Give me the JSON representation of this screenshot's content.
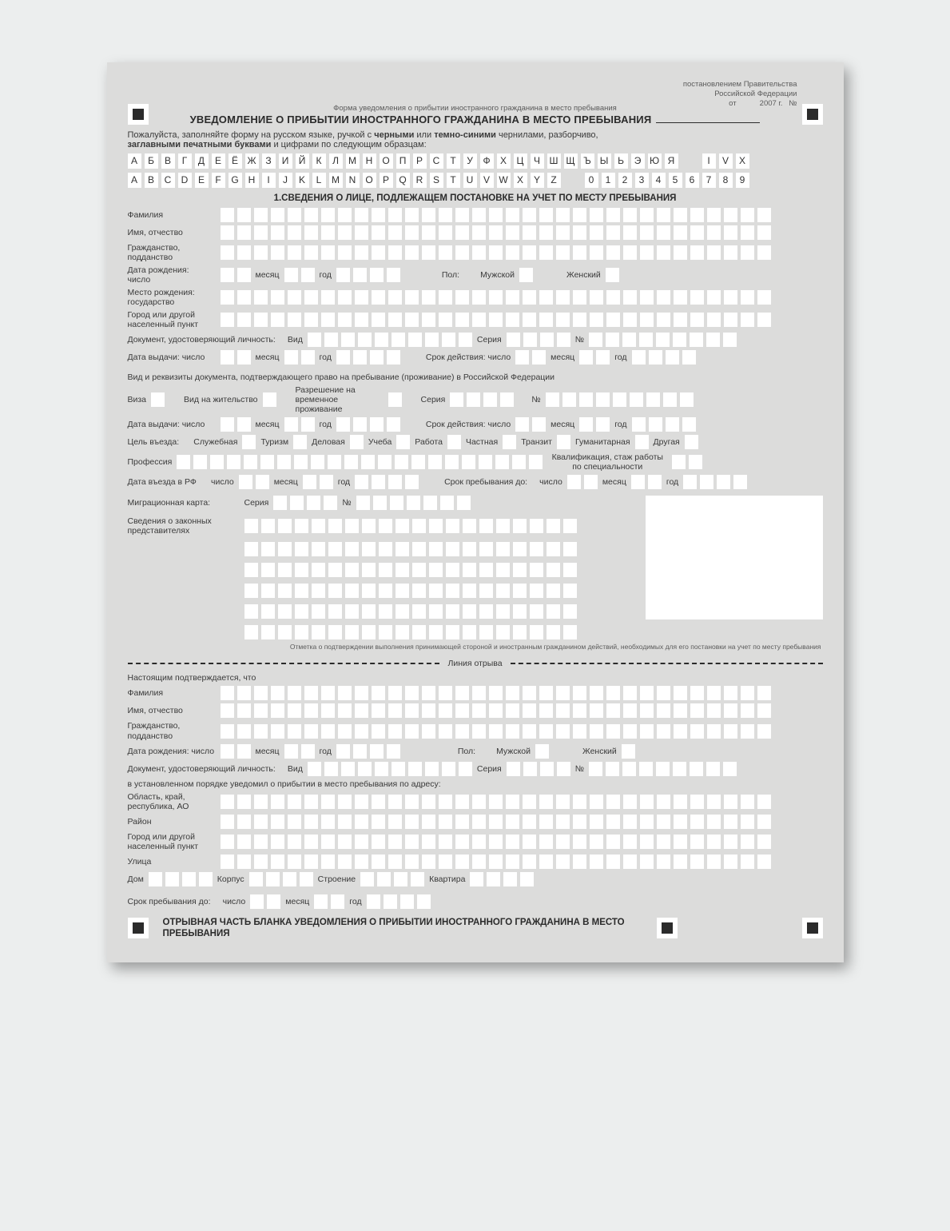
{
  "decree": {
    "l1": "постановлением Правительства",
    "l2": "Российской Федерации",
    "l3_pre": "от",
    "l3_year": "2007 г.",
    "l3_no": "№"
  },
  "header": {
    "subtitle": "Форма уведомления о прибытии иностранного гражданина в место пребывания",
    "title": "УВЕДОМЛЕНИЕ О ПРИБЫТИИ ИНОСТРАННОГО ГРАЖДАНИНА В МЕСТО ПРЕБЫВАНИЯ"
  },
  "instr_parts": {
    "p1": "Пожалуйста, заполняйте форму на русском языке, ручкой с ",
    "b1": "черными",
    "p2": " или ",
    "b2": "темно-синими",
    "p3": " чернилами, разборчиво,",
    "b3": "заглавными печатными буквами",
    "p4": " и цифрами по следующим образцам:"
  },
  "samples": {
    "cyr": "АБВГДЕЁЖЗИЙКЛМНОПРСТУФХЦЧШЩЪЫЬЭЮЯ",
    "roman": "IVX",
    "lat": "ABCDEFGHIJKLMNOPQRSTUVWXYZ",
    "digits": "0123456789"
  },
  "sec1_title": "1.СВЕДЕНИЯ О ЛИЦЕ, ПОДЛЕЖАЩЕМ ПОСТАНОВКЕ НА УЧЕТ ПО МЕСТУ ПРЕБЫВАНИЯ",
  "labels": {
    "surname": "Фамилия",
    "name_patr": "Имя, отчество",
    "citizenship": "Гражданство, подданство",
    "birth_date": "Дата рождения:",
    "day": "число",
    "month": "месяц",
    "year": "год",
    "sex": "Пол:",
    "male": "Мужской",
    "female": "Женский",
    "birth_country": "Место рождения: государство",
    "birth_city": "Город или другой населенный пункт",
    "id_doc": "Документ, удостоверяющий личность:",
    "kind": "Вид",
    "series": "Серия",
    "number": "№",
    "issue_date": "Дата выдачи: число",
    "valid_until": "Срок действия: число",
    "right_doc": "Вид и реквизиты документа, подтверждающего право на пребывание (проживание) в Российской Федерации",
    "visa": "Виза",
    "residence": "Вид на жительство",
    "temp_permit": "Разрешение на временное проживание",
    "purpose": "Цель въезда:",
    "p_service": "Служебная",
    "p_tourism": "Туризм",
    "p_business": "Деловая",
    "p_study": "Учеба",
    "p_work": "Работа",
    "p_private": "Частная",
    "p_transit": "Транзит",
    "p_human": "Гуманитарная",
    "p_other": "Другая",
    "profession": "Профессия",
    "qualif": "Квалификация, стаж работы по специальности",
    "entry_date": "Дата въезда в РФ",
    "stay_until": "Срок пребывания до:",
    "mig_card": "Миграционная карта:",
    "reps": "Сведения о законных представителях",
    "stamp_note": "Отметка о подтверждении выполнения принимающей стороной и иностранным гражданином действий, необходимых для его постановки на учет по месту пребывания"
  },
  "tear_label": "Линия отрыва",
  "tear": {
    "confirm": "Настоящим подтверждается, что",
    "notified": "в установленном порядке уведомил о прибытии в место пребывания по адресу:",
    "region": "Область, край, республика, АО",
    "district": "Район",
    "city": "Город или другой населенный пункт",
    "street": "Улица",
    "house": "Дом",
    "korpus": "Корпус",
    "building": "Строение",
    "flat": "Квартира",
    "stay_until": "Срок пребывания до:"
  },
  "footer_title": "ОТРЫВНАЯ ЧАСТЬ БЛАНКА УВЕДОМЛЕНИЯ О ПРИБЫТИИ ИНОСТРАННОГО ГРАЖДАНИНА В МЕСТО ПРЕБЫВАНИЯ"
}
